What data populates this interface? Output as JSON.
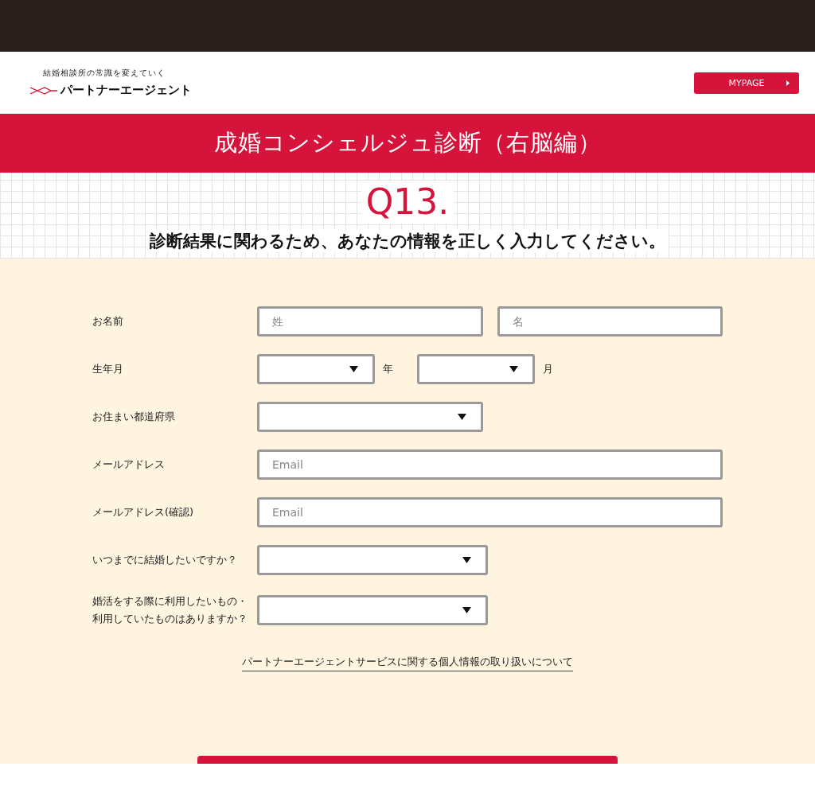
{
  "header": {
    "tagline": "結婚相談所の常識を変えていく",
    "brand": "パートナーエージェント",
    "mypage_button": "MYPAGE"
  },
  "banner": {
    "title": "成婚コンシェルジュ診断（右脳編）"
  },
  "question": {
    "number": "Q13.",
    "text": "診断結果に関わるため、あなたの情報を正しく入力してください。"
  },
  "form": {
    "fields": [
      {
        "kind": "text-pair",
        "label": "お名前",
        "inputs": [
          {
            "placeholder": "姓"
          },
          {
            "placeholder": "名"
          }
        ]
      },
      {
        "kind": "select-pair",
        "label": "生年月",
        "selects": [
          {
            "unit": "年"
          },
          {
            "unit": "月"
          }
        ]
      },
      {
        "kind": "select",
        "label": "お住まい都道府県"
      },
      {
        "kind": "text",
        "label": "メールアドレス",
        "placeholder": "Email"
      },
      {
        "kind": "text",
        "label": "メールアドレス(確認)",
        "placeholder": "Email"
      },
      {
        "kind": "select",
        "label": "いつまでに結婚したいですか？"
      },
      {
        "kind": "select",
        "label": "婚活をする際に利用したいもの・利用していたものはありますか？"
      }
    ],
    "privacy_link": "パートナーエージェントサービスに関する個人情報の取り扱いについて"
  }
}
